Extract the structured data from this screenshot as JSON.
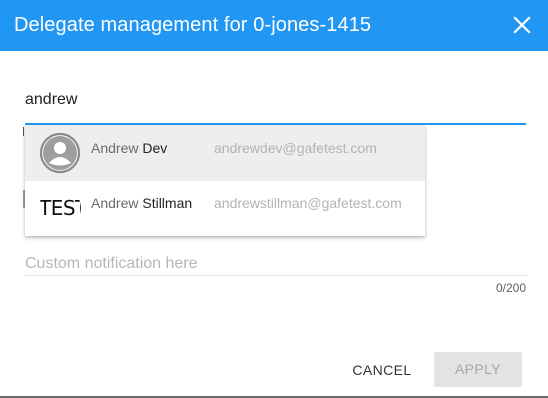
{
  "dialog": {
    "title": "Delegate management for 0-jones-1415",
    "close_icon": "close-icon"
  },
  "search": {
    "value": "andrew"
  },
  "suggestions": [
    {
      "name_match": "Andrew",
      "name_rest": " Dev",
      "email": "andrewdev@gafetest.com",
      "avatar_icon": "person-icon",
      "highlighted": true
    },
    {
      "name_match": "Andrew",
      "name_rest": " Stillman",
      "email": "andrewstillman@gafetest.com",
      "avatar_text": "TEST",
      "highlighted": false
    }
  ],
  "notification": {
    "placeholder": "Custom notification here",
    "value": "",
    "counter": "0/200"
  },
  "actions": {
    "cancel_label": "CANCEL",
    "apply_label": "APPLY"
  },
  "colors": {
    "accent": "#2196f3",
    "highlight_row": "#eeeeee",
    "disabled_button": "#e3e3e3"
  }
}
